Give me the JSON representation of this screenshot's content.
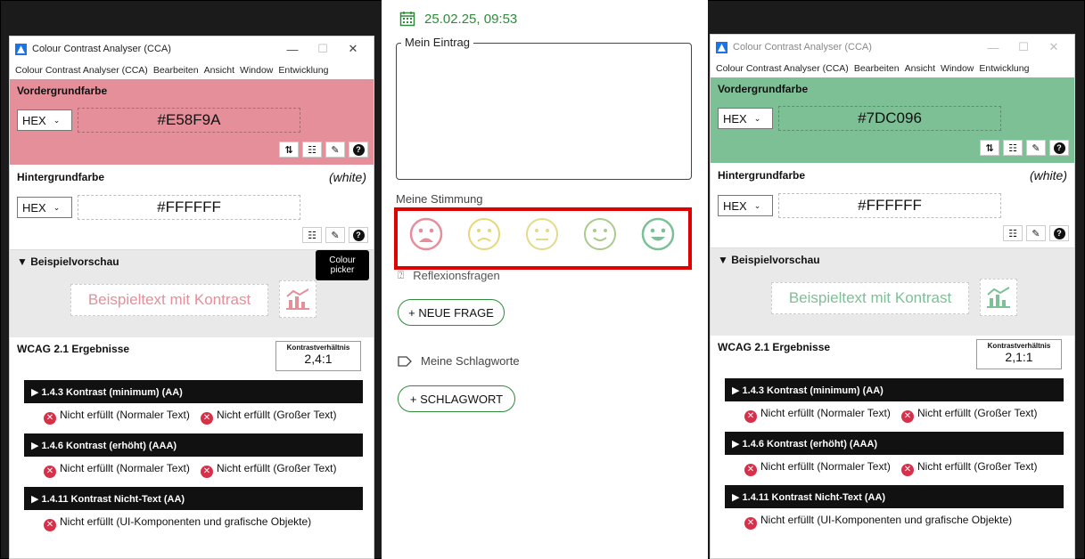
{
  "left_window": {
    "title": "Colour Contrast Analyser (CCA)",
    "menu": [
      "Colour Contrast Analyser (CCA)",
      "Bearbeiten",
      "Ansicht",
      "Window",
      "Entwicklung"
    ],
    "foreground": {
      "title": "Vordergrundfarbe",
      "format": "HEX",
      "value": "#E58F9A",
      "color": "#E58F9A"
    },
    "background": {
      "title": "Hintergrundfarbe",
      "note": "(white)",
      "format": "HEX",
      "value": "#FFFFFF"
    },
    "preview": {
      "title": "▼ Beispielvorschau",
      "sample_text": "Beispieltext mit Kontrast"
    },
    "tooltip": [
      "Colour",
      "picker"
    ],
    "results": {
      "title": "WCAG 2.1 Ergebnisse",
      "ratio_label": "Kontrastverhältnis",
      "ratio_value": "2,4:1",
      "criteria": [
        {
          "label": "▶ 1.4.3 Kontrast (minimum) (AA)",
          "res1": "Nicht erfüllt (Normaler Text)",
          "res2": "Nicht erfüllt (Großer Text)"
        },
        {
          "label": "▶ 1.4.6 Kontrast (erhöht) (AAA)",
          "res1": "Nicht erfüllt (Normaler Text)",
          "res2": "Nicht erfüllt (Großer Text)"
        },
        {
          "label": "▶ 1.4.11 Kontrast Nicht-Text (AA)",
          "res1": "Nicht erfüllt (UI-Komponenten und grafische Objekte)"
        }
      ]
    }
  },
  "right_window": {
    "title": "Colour Contrast Analyser (CCA)",
    "menu": [
      "Colour Contrast Analyser (CCA)",
      "Bearbeiten",
      "Ansicht",
      "Window",
      "Entwicklung"
    ],
    "foreground": {
      "title": "Vordergrundfarbe",
      "format": "HEX",
      "value": "#7DC096",
      "color": "#7DC096"
    },
    "background": {
      "title": "Hintergrundfarbe",
      "note": "(white)",
      "format": "HEX",
      "value": "#FFFFFF"
    },
    "preview": {
      "title": "▼ Beispielvorschau",
      "sample_text": "Beispieltext mit Kontrast"
    },
    "results": {
      "title": "WCAG 2.1 Ergebnisse",
      "ratio_label": "Kontrastverhältnis",
      "ratio_value": "2,1:1",
      "criteria": [
        {
          "label": "▶ 1.4.3 Kontrast (minimum) (AA)",
          "res1": "Nicht erfüllt (Normaler Text)",
          "res2": "Nicht erfüllt (Großer Text)"
        },
        {
          "label": "▶ 1.4.6 Kontrast (erhöht) (AAA)",
          "res1": "Nicht erfüllt (Normaler Text)",
          "res2": "Nicht erfüllt (Großer Text)"
        },
        {
          "label": "▶ 1.4.11 Kontrast Nicht-Text (AA)",
          "res1": "Nicht erfüllt (UI-Komponenten und grafische Objekte)"
        }
      ]
    }
  },
  "center_app": {
    "datetime": "25.02.25, 09:53",
    "entry_label": "Mein Eintrag",
    "mood_label": "Meine Stimmung",
    "moods": [
      {
        "name": "very-sad",
        "color": "#E58F9A"
      },
      {
        "name": "sad",
        "color": "#E6D77A"
      },
      {
        "name": "neutral",
        "color": "#E3DA8C"
      },
      {
        "name": "happy",
        "color": "#A9CB8E"
      },
      {
        "name": "very-happy",
        "color": "#7DC096"
      }
    ],
    "reflection_label": "Reflexionsfragen",
    "new_question_button": "+ NEUE FRAGE",
    "tags_label": "Meine Schlagworte",
    "tag_button": "+ SCHLAGWORT",
    "accent_color": "#2E8B3A",
    "highlight_color": "#E00000"
  }
}
